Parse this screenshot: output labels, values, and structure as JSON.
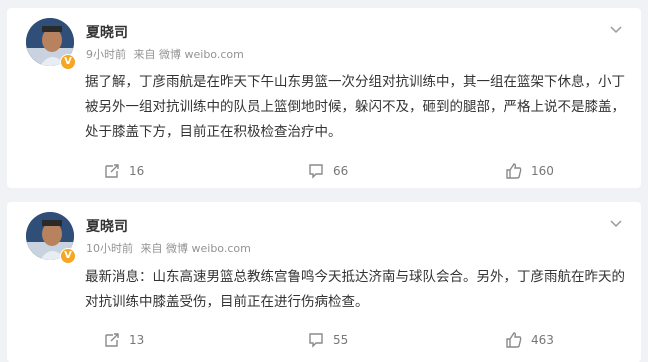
{
  "posts": [
    {
      "author": "夏晓司",
      "time": "9小时前",
      "source": "来自 微博 weibo.com",
      "text": "据了解，丁彦雨航是在昨天下午山东男篮一次分组对抗训练中，其一组在篮架下休息，小丁被另外一组对抗训练中的队员上篮倒地时候，躲闪不及，砸到的腿部，严格上说不是膝盖，处于膝盖下方，目前正在积极检查治疗中。",
      "reposts": "16",
      "comments": "66",
      "likes": "160"
    },
    {
      "author": "夏晓司",
      "time": "10小时前",
      "source": "来自 微博 weibo.com",
      "text": "最新消息：山东高速男篮总教练宫鲁鸣今天抵达济南与球队会合。另外，丁彦雨航在昨天的对抗训练中膝盖受伤，目前正在进行伤病检查。",
      "reposts": "13",
      "comments": "55",
      "likes": "463"
    }
  ],
  "icons": {
    "repost": "repost-icon",
    "comment": "comment-icon",
    "like": "like-icon",
    "more": "chevron-down-icon",
    "verified": "verified-badge-icon"
  },
  "colors": {
    "background": "#f1f2f5",
    "card": "#ffffff",
    "badge": "#f5a623",
    "meta_text": "#939393"
  }
}
